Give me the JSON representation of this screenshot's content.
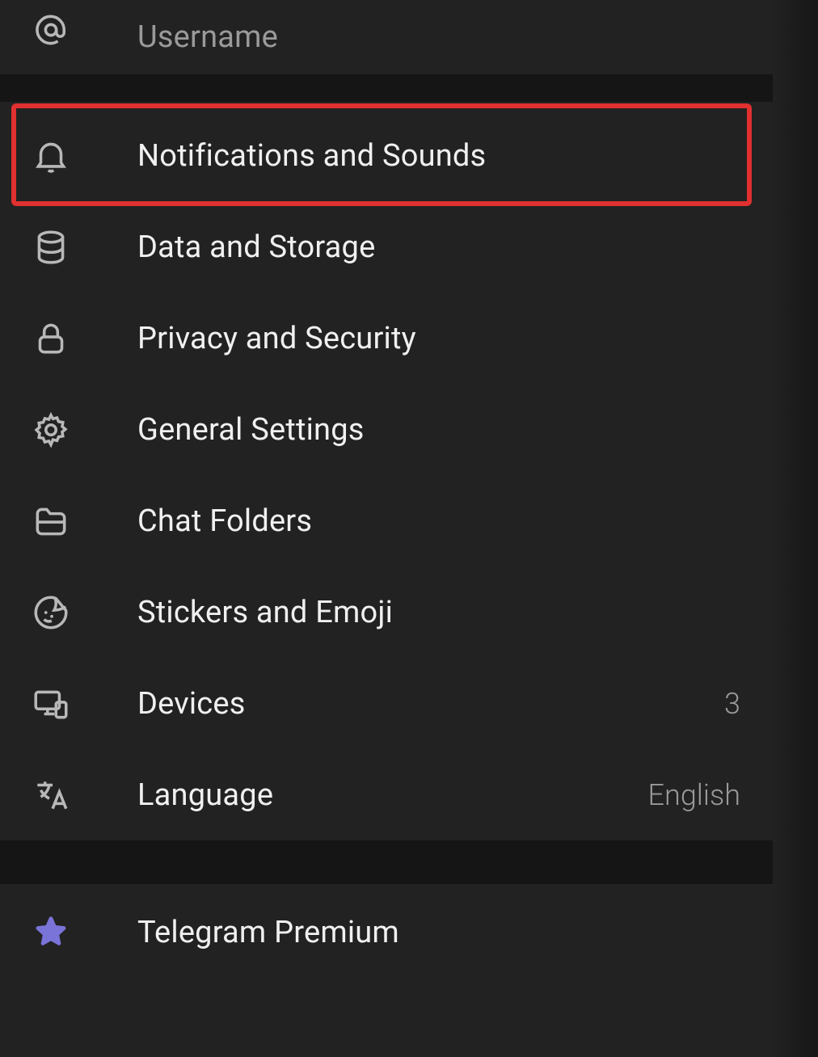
{
  "top": {
    "username_label": "Username"
  },
  "items": [
    {
      "label": "Notifications and Sounds",
      "value": ""
    },
    {
      "label": "Data and Storage",
      "value": ""
    },
    {
      "label": "Privacy and Security",
      "value": ""
    },
    {
      "label": "General Settings",
      "value": ""
    },
    {
      "label": "Chat Folders",
      "value": ""
    },
    {
      "label": "Stickers and Emoji",
      "value": ""
    },
    {
      "label": "Devices",
      "value": "3"
    },
    {
      "label": "Language",
      "value": "English"
    }
  ],
  "premium": {
    "label": "Telegram Premium"
  }
}
